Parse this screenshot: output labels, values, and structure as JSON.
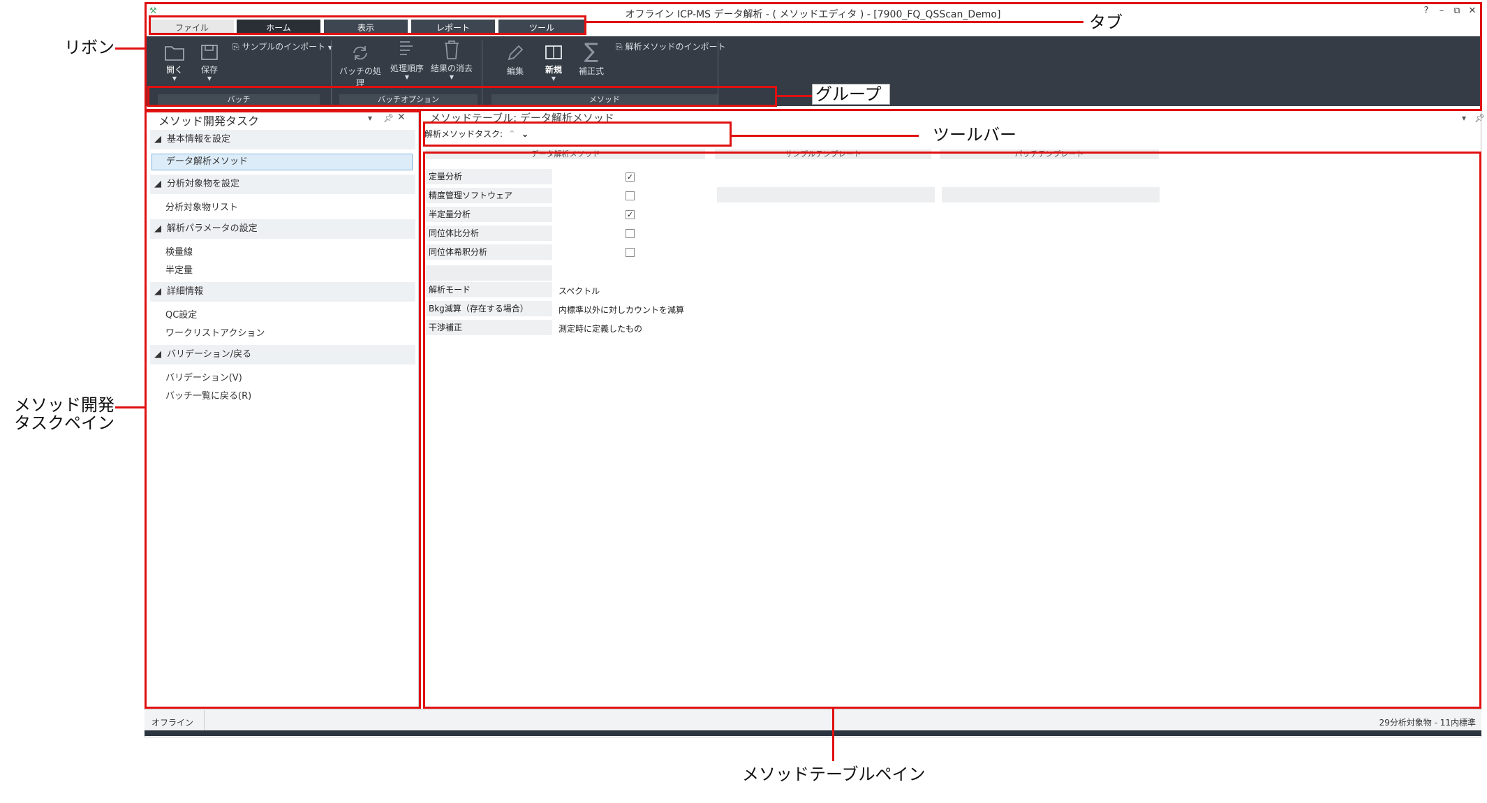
{
  "window": {
    "title": "オフライン ICP-MS データ解析 - ( メソッドエディタ ) - [7900_FQ_QSScan_Demo]",
    "help": "?",
    "minimize": "–",
    "restore": "⧉",
    "close": "✕"
  },
  "tabs": [
    {
      "label": "ファイル"
    },
    {
      "label": "ホーム"
    },
    {
      "label": "表示"
    },
    {
      "label": "レポート"
    },
    {
      "label": "ツール"
    }
  ],
  "ribbon": {
    "open": "開く",
    "save": "保存",
    "import_sample": "サンプルのインポート",
    "process_batch": "バッチの処理",
    "process_order": "処理順序",
    "clear_results": "結果の消去",
    "edit": "編集",
    "new": "新規",
    "correction": "補正式",
    "import_method": "解析メソッドのインポート",
    "groups": [
      "バッチ",
      "バッチオプション",
      "メソッド"
    ]
  },
  "left_pane": {
    "title": "メソッド開発タスク",
    "sections": [
      {
        "header": "基本情報を設定",
        "items": [
          "データ解析メソッド"
        ]
      },
      {
        "header": "分析対象物を設定",
        "items": [
          "分析対象物リスト"
        ]
      },
      {
        "header": "解析パラメータの設定",
        "items": [
          "検量線",
          "半定量"
        ]
      },
      {
        "header": "詳細情報",
        "items": [
          "QC設定",
          "ワークリストアクション"
        ]
      },
      {
        "header": "バリデーション/戻る",
        "items": [
          "バリデーション(V)",
          "バッチ一覧に戻る(R)"
        ]
      }
    ]
  },
  "right_pane": {
    "title": "メソッドテーブル: データ解析メソッド",
    "toolbar_label": "解析メソッドタスク:",
    "columns": [
      "データ解析メソッド",
      "サンプルテンプレート",
      "バッチテンプレート"
    ],
    "rows": [
      {
        "label": "定量分析",
        "checked": true
      },
      {
        "label": "精度管理ソフトウェア",
        "checked": false
      },
      {
        "label": "半定量分析",
        "checked": true
      },
      {
        "label": "同位体比分析",
        "checked": false
      },
      {
        "label": "同位体希釈分析",
        "checked": false
      }
    ],
    "settings": [
      {
        "label": "解析モード",
        "value": "スペクトル"
      },
      {
        "label": "Bkg減算（存在する場合）",
        "value": "内標準以外に対しカウントを減算"
      },
      {
        "label": "干渉補正",
        "value": "測定時に定義したもの"
      }
    ]
  },
  "statusbar": {
    "left": "オフライン",
    "right": "29分析対象物 - 11内標準"
  },
  "callouts": {
    "ribbon": "リボン",
    "tab": "タブ",
    "group": "グループ",
    "toolbar": "ツールバー",
    "task_pane_line1": "メソッド開発",
    "task_pane_line2": "タスクペイン",
    "table_pane": "メソッドテーブルペイン"
  },
  "colors": {
    "ribbon_bg": "#353c45",
    "callout_red": "#e01010",
    "selected_item": "#dcecf8"
  }
}
